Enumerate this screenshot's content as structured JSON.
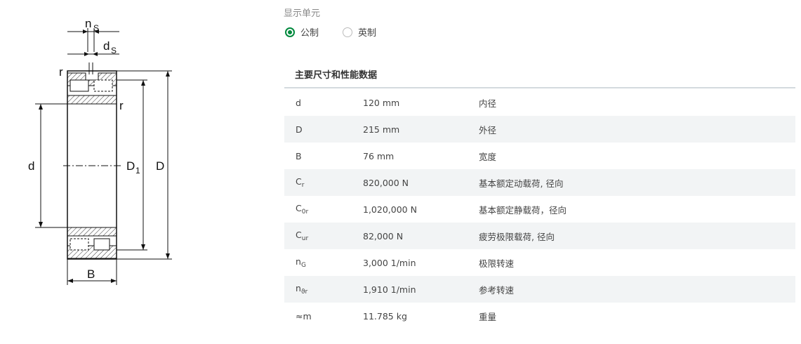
{
  "diagram": {
    "labels": {
      "ns_main": "n",
      "ns_sub": "S",
      "ds_main": "d",
      "ds_sub": "S",
      "r": "r",
      "d": "d",
      "D1_main": "D",
      "D1_sub": "1",
      "D": "D",
      "B": "B"
    }
  },
  "units": {
    "label": "显示单元",
    "options": [
      "公制",
      "英制"
    ],
    "selected": "公制"
  },
  "table": {
    "title": "主要尺寸和性能数据",
    "rows": [
      {
        "sym": "d",
        "sub": "",
        "value": "120 mm",
        "desc": "内径"
      },
      {
        "sym": "D",
        "sub": "",
        "value": "215 mm",
        "desc": "外径"
      },
      {
        "sym": "B",
        "sub": "",
        "value": "76 mm",
        "desc": "宽度"
      },
      {
        "sym": "C",
        "sub": "r",
        "value": "820,000 N",
        "desc": "基本额定动载荷, 径向"
      },
      {
        "sym": "C",
        "sub": "0r",
        "value": "1,020,000 N",
        "desc": "基本额定静载荷，径向"
      },
      {
        "sym": "C",
        "sub": "ur",
        "value": "82,000 N",
        "desc": "疲劳极限载荷, 径向"
      },
      {
        "sym": "n",
        "sub": "G",
        "value": "3,000 1/min",
        "desc": "极限转速"
      },
      {
        "sym": "n",
        "sub": "ϑr",
        "value": "1,910 1/min",
        "desc": "参考转速"
      },
      {
        "sym": "≈m",
        "sub": "",
        "value": "11.785 kg",
        "desc": "重量"
      }
    ]
  }
}
